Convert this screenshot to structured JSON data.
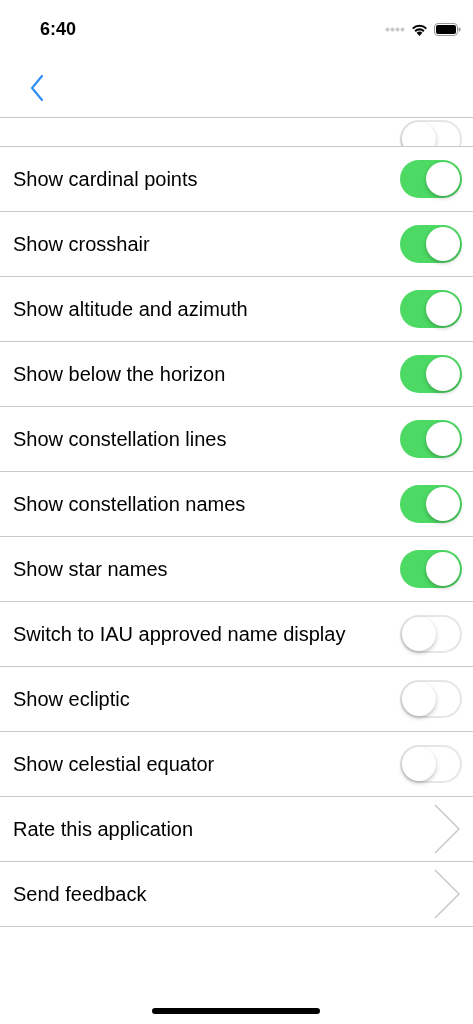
{
  "status_bar": {
    "time": "6:40"
  },
  "partial_row": {
    "on": false
  },
  "rows": [
    {
      "kind": "toggle",
      "label": "Show cardinal points",
      "on": true
    },
    {
      "kind": "toggle",
      "label": "Show crosshair",
      "on": true
    },
    {
      "kind": "toggle",
      "label": "Show altitude and azimuth",
      "on": true
    },
    {
      "kind": "toggle",
      "label": "Show below the horizon",
      "on": true
    },
    {
      "kind": "toggle",
      "label": "Show constellation lines",
      "on": true
    },
    {
      "kind": "toggle",
      "label": "Show constellation names",
      "on": true
    },
    {
      "kind": "toggle",
      "label": "Show star names",
      "on": true
    },
    {
      "kind": "toggle",
      "label": "Switch to IAU approved name display",
      "on": false
    },
    {
      "kind": "toggle",
      "label": "Show ecliptic",
      "on": false
    },
    {
      "kind": "toggle",
      "label": "Show celestial equator",
      "on": false
    },
    {
      "kind": "link",
      "label": "Rate this application"
    },
    {
      "kind": "link",
      "label": "Send feedback"
    }
  ]
}
